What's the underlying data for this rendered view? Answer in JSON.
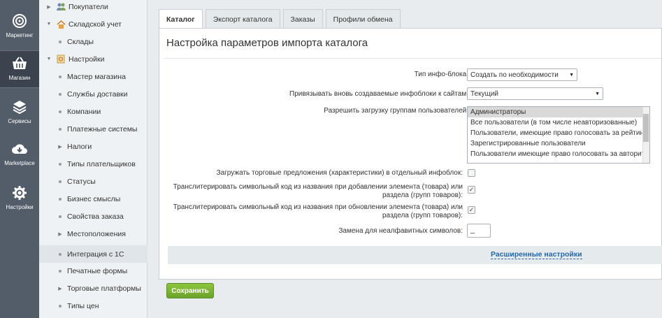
{
  "leftnav": [
    {
      "label": "Маркетинг",
      "icon": "target-icon"
    },
    {
      "label": "Магазин",
      "icon": "basket-icon"
    },
    {
      "label": "Сервисы",
      "icon": "layers-icon"
    },
    {
      "label": "Marketplace",
      "icon": "cloud-download-icon"
    },
    {
      "label": "Настройки",
      "icon": "gear-icon"
    }
  ],
  "tree": [
    {
      "label": "Покупатели",
      "type": "folder"
    },
    {
      "label": "Складской учет",
      "type": "folder-open"
    },
    {
      "label": "Склады",
      "type": "leaf"
    },
    {
      "label": "Настройки",
      "type": "folder-open"
    },
    {
      "label": "Мастер магазина",
      "type": "leaf"
    },
    {
      "label": "Службы доставки",
      "type": "leaf"
    },
    {
      "label": "Компании",
      "type": "leaf"
    },
    {
      "label": "Платежные системы",
      "type": "leaf"
    },
    {
      "label": "Налоги",
      "type": "collapsed"
    },
    {
      "label": "Типы плательщиков",
      "type": "leaf"
    },
    {
      "label": "Статусы",
      "type": "leaf"
    },
    {
      "label": "Бизнес смыслы",
      "type": "leaf"
    },
    {
      "label": "Свойства заказа",
      "type": "leaf"
    },
    {
      "label": "Местоположения",
      "type": "collapsed"
    },
    {
      "label": "Интеграция с 1С",
      "type": "leaf"
    },
    {
      "label": "Печатные формы",
      "type": "leaf"
    },
    {
      "label": "Торговые платформы",
      "type": "collapsed"
    },
    {
      "label": "Типы цен",
      "type": "leaf"
    }
  ],
  "tabs": [
    "Каталог",
    "Экспорт каталога",
    "Заказы",
    "Профили обмена"
  ],
  "panel": {
    "title": "Настройка параметров импорта каталога",
    "iblock_type_label": "Тип инфо-блока:",
    "iblock_type_value": "Создать по необходимости",
    "bind_sites_label": "Привязывать вновь создаваемые инфоблоки к сайтам:",
    "bind_sites_value": "Текущий",
    "groups_label": "Разрешить загрузку группам пользователей:",
    "groups": [
      "Администраторы",
      "Все пользователи (в том числе неавторизованные)",
      "Пользователи, имеющие право голосовать за рейтинг",
      "Зарегистрированные пользователи",
      "Пользователи имеющие право голосовать за авторитет"
    ],
    "offers_label": "Загружать торговые предложения (характеристики) в отдельный инфоблок:",
    "translit_add_label1": "Транслитерировать символьный код из названия при добавлении элемента (товара) или",
    "translit_add_label2": "раздела (групп товаров):",
    "translit_update_label1": "Транслитерировать символьный код из названия при обновлении элемента (товара) или",
    "translit_update_label2": "раздела (групп товаров):",
    "replace_label": "Замена для неалфавитных символов:",
    "replace_value": "_",
    "advanced_link": "Расширенные настройки",
    "check_mark": "✓"
  },
  "save_label": "Сохранить",
  "colors": {
    "nav_bg": "#535c69",
    "save_green": "#7ab535",
    "link_blue": "#2067b0"
  }
}
